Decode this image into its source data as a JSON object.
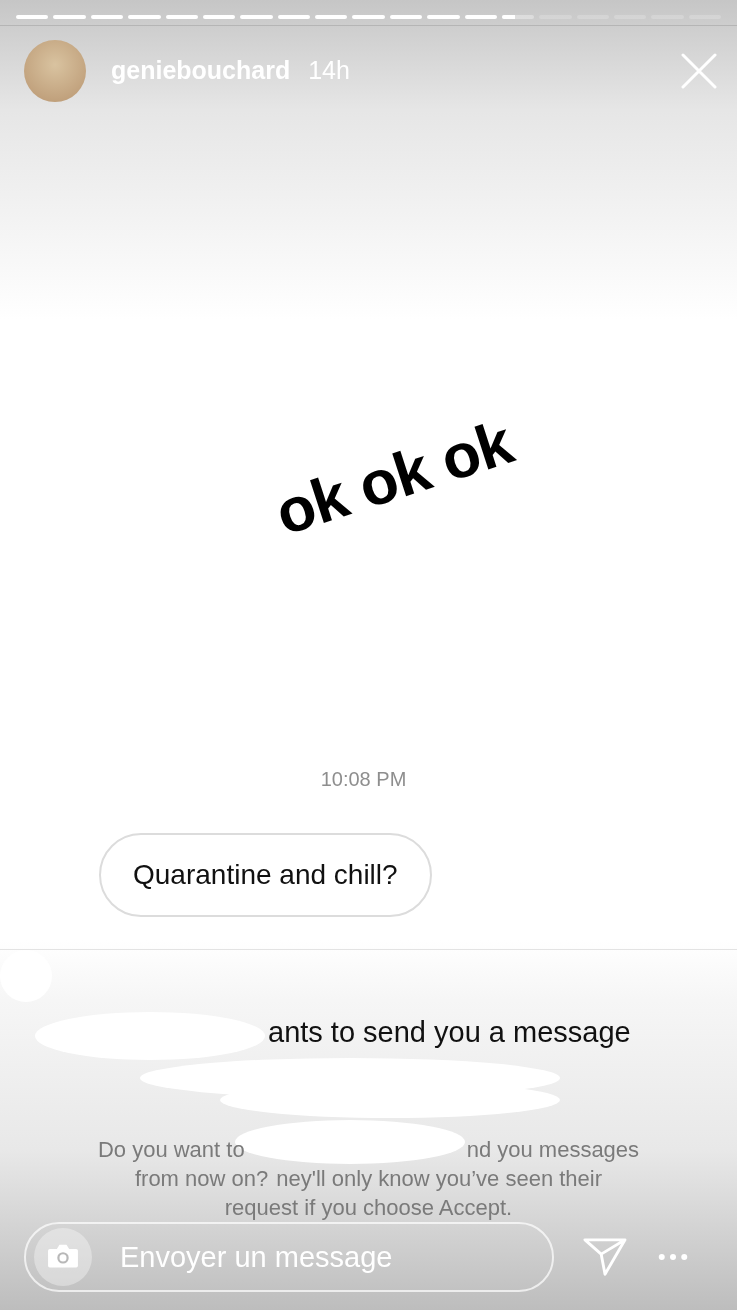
{
  "story": {
    "progress": [
      {
        "upcoming": false,
        "level": 1
      },
      {
        "upcoming": false,
        "level": 1
      },
      {
        "upcoming": false,
        "level": 1
      },
      {
        "upcoming": false,
        "level": 1
      },
      {
        "upcoming": false,
        "level": 1
      },
      {
        "upcoming": false,
        "level": 1
      },
      {
        "upcoming": false,
        "level": 1
      },
      {
        "upcoming": false,
        "level": 1
      },
      {
        "upcoming": false,
        "level": 1
      },
      {
        "upcoming": false,
        "level": 1
      },
      {
        "upcoming": false,
        "level": 1
      },
      {
        "upcoming": false,
        "level": 1
      },
      {
        "upcoming": false,
        "level": 1
      },
      {
        "upcoming": false,
        "level": 0.4
      },
      {
        "upcoming": true
      },
      {
        "upcoming": true
      },
      {
        "upcoming": true
      },
      {
        "upcoming": true
      },
      {
        "upcoming": true
      }
    ],
    "username": "geniebouchard",
    "time": "14h"
  },
  "sticker": "ok ok ok",
  "chat": {
    "timestamp": "10:08 PM",
    "message": "Quarantine and chill?",
    "request_title": "ants to send you a message",
    "request_lines": [
      {
        "parts": [
          "Do you want to",
          "nd you messages"
        ]
      },
      {
        "parts": [
          "from now on?",
          "ney'll only know you’ve seen their"
        ]
      },
      {
        "parts": [
          "request if you choose Accept."
        ]
      }
    ]
  },
  "reply": {
    "placeholder": "Envoyer un message"
  }
}
